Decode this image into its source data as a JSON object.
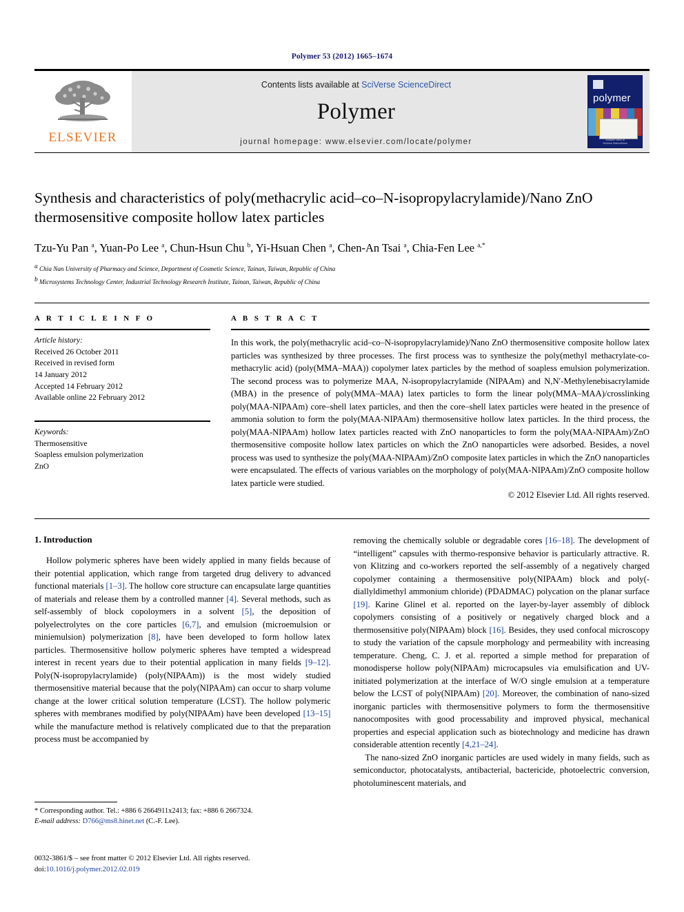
{
  "running_head": "Polymer 53 (2012) 1665–1674",
  "banner": {
    "publisher_name": "ELSEVIER",
    "contents_prefix": "Contents lists available at ",
    "contents_link": "SciVerse ScienceDirect",
    "journal_name": "Polymer",
    "journal_homepage": "journal homepage: www.elsevier.com/locate/polymer",
    "cover": {
      "title": "polymer",
      "footer_line1": "Available online at",
      "footer_line2": "SciVerse ScienceDirect"
    }
  },
  "title": "Synthesis and characteristics of poly(methacrylic acid–co–N-isopropylacrylamide)/Nano ZnO thermosensitive composite hollow latex particles",
  "authors": "Tzu-Yu Pan a, Yuan-Po Lee a, Chun-Hsun Chu b, Yi-Hsuan Chen a, Chen-An Tsai a, Chia-Fen Lee a,*",
  "affiliations": [
    "a Chia Nan University of Pharmacy and Science, Department of Cosmetic Science, Tainan, Taiwan, Republic of China",
    "b Microsystems Technology Center, Industrial Technology Research Institute, Tainan, Taiwan, Republic of China"
  ],
  "article_info": {
    "heading": "A R T I C L E   I N F O",
    "history_label": "Article history:",
    "history": [
      "Received 26 October 2011",
      "Received in revised form",
      "14 January 2012",
      "Accepted 14 February 2012",
      "Available online 22 February 2012"
    ],
    "keywords_label": "Keywords:",
    "keywords": [
      "Thermosensitive",
      "Soapless emulsion polymerization",
      "ZnO"
    ]
  },
  "abstract": {
    "heading": "A B S T R A C T",
    "text": "In this work, the poly(methacrylic acid–co–N-isopropylacrylamide)/Nano ZnO thermosensitive composite hollow latex particles was synthesized by three processes. The first process was to synthesize the poly(methyl methacrylate-co- methacrylic acid) (poly(MMA–MAA)) copolymer latex particles by the method of soapless emulsion polymerization. The second process was to polymerize MAA, N-isopropylacrylamide (NIPAAm) and N,N′-Methylenebisacrylamide (MBA) in the presence of poly(MMA–MAA) latex particles to form the linear poly(MMA–MAA)/crosslinking poly(MAA-NIPAAm) core–shell latex particles, and then the core–shell latex particles were heated in the presence of ammonia solution to form the poly(MAA-NIPAAm) thermosensitive hollow latex particles. In the third process, the poly(MAA-NIPAAm) hollow latex particles reacted with ZnO nanoparticles to form the poly(MAA-NIPAAm)/ZnO thermosensitive composite hollow latex particles on which the ZnO nanoparticles were adsorbed. Besides, a novel process was used to synthesize the poly(MAA-NIPAAm)/ZnO composite latex particles in which the ZnO nanoparticles were encapsulated. The effects of various variables on the morphology of poly(MAA-NIPAAm)/ZnO composite hollow latex particle were studied.",
    "copyright": "© 2012 Elsevier Ltd. All rights reserved."
  },
  "body": {
    "section_number_title": "1.  Introduction",
    "left_paragraph_1_a": "Hollow polymeric spheres have been widely applied in many fields because of their potential application, which range from targeted drug delivery to advanced functional materials ",
    "left_ref_1": "[1–3]",
    "left_paragraph_1_b": ". The hollow core structure can encapsulate large quantities of materials and release them by a controlled manner ",
    "left_ref_2": "[4]",
    "left_paragraph_1_c": ". Several methods, such as self-assembly of block copoloymers in a solvent ",
    "left_ref_3": "[5]",
    "left_paragraph_1_d": ", the deposition of polyelectrolytes on the core particles ",
    "left_ref_4": "[6,7]",
    "left_paragraph_1_e": ", and emulsion (microemulsion or miniemulsion) polymerization ",
    "left_ref_5": "[8]",
    "left_paragraph_1_f": ", have been developed to form hollow latex particles. Thermosensitive hollow polymeric spheres have tempted a widespread interest in recent years due to their potential application in many fields ",
    "left_ref_6": "[9–12]",
    "left_paragraph_1_g": ". Poly(N-isopropylacrylamide) (poly(NIPAAm)) is the most widely studied thermosensitive material because that the poly(NIPAAm) can occur to sharp volume change at the lower critical solution temperature (LCST). The hollow polymeric spheres with membranes modified by poly(NIPAAm) have been developed ",
    "left_ref_7": "[13–15]",
    "left_paragraph_1_h": " while the manufacture method is relatively complicated due to that the preparation process must be accompanied by",
    "right_paragraph_1_a": "removing the chemically soluble or degradable cores ",
    "right_ref_1": "[16–18]",
    "right_paragraph_1_b": ". The development of “intelligent” capsules with thermo-responsive behavior is particularly attractive. R. von Klitzing and co-workers reported the self-assembly of a negatively charged copolymer containing a thermosensitive poly(NIPAAm) block and poly(-diallyldimethyl ammonium chloride) (PDADMAC) polycation on the planar surface ",
    "right_ref_2": "[19]",
    "right_paragraph_1_c": ". Karine Glinel et al. reported on the layer-by-layer assembly of diblock copolymers consisting of a positively or negatively charged block and a thermosensitive poly(NIPAAm) block ",
    "right_ref_3": "[16]",
    "right_paragraph_1_d": ". Besides, they used confocal microscopy to study the variation of the capsule morphology and permeability with increasing temperature. Cheng, C. J. et al. reported a simple method for preparation of monodisperse hollow poly(NIPAAm) microcapsules via emulsification and UV-initiated polymerization at the interface of W/O single emulsion at a temperature below the LCST of poly(NIPAAm) ",
    "right_ref_4": "[20]",
    "right_paragraph_1_e": ". Moreover, the combination of nano-sized inorganic particles with thermosensitive polymers to form the thermosensitive nanocomposites with good processability and improved physical, mechanical properties and especial application such as biotechnology and medicine has drawn considerable attention recently ",
    "right_ref_5": "[4,21–24]",
    "right_paragraph_1_f": ".",
    "right_paragraph_2": "The nano-sized ZnO inorganic particles are used widely in many fields, such as semiconductor, photocatalysts, antibacterial, bactericide, photoelectric conversion, photoluminescent materials, and"
  },
  "footnote": {
    "corresponding": "* Corresponding author. Tel.: +886 6 2664911x2413; fax: +886 6 2667324.",
    "email_label": "E-mail address:",
    "email": "D766@ms8.hinet.net",
    "email_suffix": "(C.-F. Lee)."
  },
  "imprint": {
    "line1": "0032-3861/$ – see front matter © 2012 Elsevier Ltd. All rights reserved.",
    "doi_label": "doi:",
    "doi": "10.1016/j.polymer.2012.02.019"
  },
  "colors": {
    "running_head": "#1a1a6e",
    "link": "#2b55a8",
    "reference": "#1a3f9e",
    "elsevier_orange": "#E87722",
    "banner_gray": "#e6e6e6",
    "cover_navy": "#12206b"
  }
}
